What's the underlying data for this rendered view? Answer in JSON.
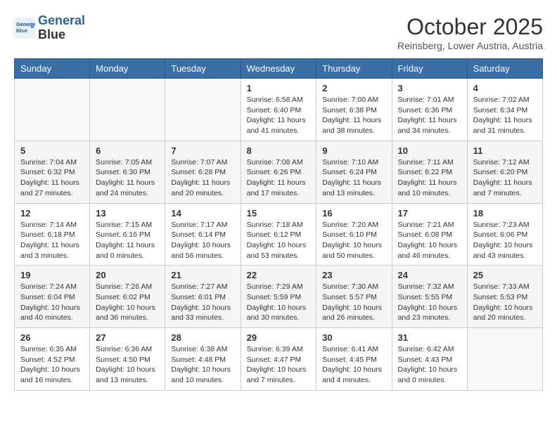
{
  "header": {
    "logo_line1": "General",
    "logo_line2": "Blue",
    "month": "October 2025",
    "location": "Reinsberg, Lower Austria, Austria"
  },
  "days_of_week": [
    "Sunday",
    "Monday",
    "Tuesday",
    "Wednesday",
    "Thursday",
    "Friday",
    "Saturday"
  ],
  "weeks": [
    [
      {
        "day": "",
        "sunrise": "",
        "sunset": "",
        "daylight": ""
      },
      {
        "day": "",
        "sunrise": "",
        "sunset": "",
        "daylight": ""
      },
      {
        "day": "",
        "sunrise": "",
        "sunset": "",
        "daylight": ""
      },
      {
        "day": "1",
        "sunrise": "Sunrise: 6:58 AM",
        "sunset": "Sunset: 6:40 PM",
        "daylight": "Daylight: 11 hours and 41 minutes."
      },
      {
        "day": "2",
        "sunrise": "Sunrise: 7:00 AM",
        "sunset": "Sunset: 6:38 PM",
        "daylight": "Daylight: 11 hours and 38 minutes."
      },
      {
        "day": "3",
        "sunrise": "Sunrise: 7:01 AM",
        "sunset": "Sunset: 6:36 PM",
        "daylight": "Daylight: 11 hours and 34 minutes."
      },
      {
        "day": "4",
        "sunrise": "Sunrise: 7:02 AM",
        "sunset": "Sunset: 6:34 PM",
        "daylight": "Daylight: 11 hours and 31 minutes."
      }
    ],
    [
      {
        "day": "5",
        "sunrise": "Sunrise: 7:04 AM",
        "sunset": "Sunset: 6:32 PM",
        "daylight": "Daylight: 11 hours and 27 minutes."
      },
      {
        "day": "6",
        "sunrise": "Sunrise: 7:05 AM",
        "sunset": "Sunset: 6:30 PM",
        "daylight": "Daylight: 11 hours and 24 minutes."
      },
      {
        "day": "7",
        "sunrise": "Sunrise: 7:07 AM",
        "sunset": "Sunset: 6:28 PM",
        "daylight": "Daylight: 11 hours and 20 minutes."
      },
      {
        "day": "8",
        "sunrise": "Sunrise: 7:08 AM",
        "sunset": "Sunset: 6:26 PM",
        "daylight": "Daylight: 11 hours and 17 minutes."
      },
      {
        "day": "9",
        "sunrise": "Sunrise: 7:10 AM",
        "sunset": "Sunset: 6:24 PM",
        "daylight": "Daylight: 11 hours and 13 minutes."
      },
      {
        "day": "10",
        "sunrise": "Sunrise: 7:11 AM",
        "sunset": "Sunset: 6:22 PM",
        "daylight": "Daylight: 11 hours and 10 minutes."
      },
      {
        "day": "11",
        "sunrise": "Sunrise: 7:12 AM",
        "sunset": "Sunset: 6:20 PM",
        "daylight": "Daylight: 11 hours and 7 minutes."
      }
    ],
    [
      {
        "day": "12",
        "sunrise": "Sunrise: 7:14 AM",
        "sunset": "Sunset: 6:18 PM",
        "daylight": "Daylight: 11 hours and 3 minutes."
      },
      {
        "day": "13",
        "sunrise": "Sunrise: 7:15 AM",
        "sunset": "Sunset: 6:16 PM",
        "daylight": "Daylight: 11 hours and 0 minutes."
      },
      {
        "day": "14",
        "sunrise": "Sunrise: 7:17 AM",
        "sunset": "Sunset: 6:14 PM",
        "daylight": "Daylight: 10 hours and 56 minutes."
      },
      {
        "day": "15",
        "sunrise": "Sunrise: 7:18 AM",
        "sunset": "Sunset: 6:12 PM",
        "daylight": "Daylight: 10 hours and 53 minutes."
      },
      {
        "day": "16",
        "sunrise": "Sunrise: 7:20 AM",
        "sunset": "Sunset: 6:10 PM",
        "daylight": "Daylight: 10 hours and 50 minutes."
      },
      {
        "day": "17",
        "sunrise": "Sunrise: 7:21 AM",
        "sunset": "Sunset: 6:08 PM",
        "daylight": "Daylight: 10 hours and 46 minutes."
      },
      {
        "day": "18",
        "sunrise": "Sunrise: 7:23 AM",
        "sunset": "Sunset: 6:06 PM",
        "daylight": "Daylight: 10 hours and 43 minutes."
      }
    ],
    [
      {
        "day": "19",
        "sunrise": "Sunrise: 7:24 AM",
        "sunset": "Sunset: 6:04 PM",
        "daylight": "Daylight: 10 hours and 40 minutes."
      },
      {
        "day": "20",
        "sunrise": "Sunrise: 7:26 AM",
        "sunset": "Sunset: 6:02 PM",
        "daylight": "Daylight: 10 hours and 36 minutes."
      },
      {
        "day": "21",
        "sunrise": "Sunrise: 7:27 AM",
        "sunset": "Sunset: 6:01 PM",
        "daylight": "Daylight: 10 hours and 33 minutes."
      },
      {
        "day": "22",
        "sunrise": "Sunrise: 7:29 AM",
        "sunset": "Sunset: 5:59 PM",
        "daylight": "Daylight: 10 hours and 30 minutes."
      },
      {
        "day": "23",
        "sunrise": "Sunrise: 7:30 AM",
        "sunset": "Sunset: 5:57 PM",
        "daylight": "Daylight: 10 hours and 26 minutes."
      },
      {
        "day": "24",
        "sunrise": "Sunrise: 7:32 AM",
        "sunset": "Sunset: 5:55 PM",
        "daylight": "Daylight: 10 hours and 23 minutes."
      },
      {
        "day": "25",
        "sunrise": "Sunrise: 7:33 AM",
        "sunset": "Sunset: 5:53 PM",
        "daylight": "Daylight: 10 hours and 20 minutes."
      }
    ],
    [
      {
        "day": "26",
        "sunrise": "Sunrise: 6:35 AM",
        "sunset": "Sunset: 4:52 PM",
        "daylight": "Daylight: 10 hours and 16 minutes."
      },
      {
        "day": "27",
        "sunrise": "Sunrise: 6:36 AM",
        "sunset": "Sunset: 4:50 PM",
        "daylight": "Daylight: 10 hours and 13 minutes."
      },
      {
        "day": "28",
        "sunrise": "Sunrise: 6:38 AM",
        "sunset": "Sunset: 4:48 PM",
        "daylight": "Daylight: 10 hours and 10 minutes."
      },
      {
        "day": "29",
        "sunrise": "Sunrise: 6:39 AM",
        "sunset": "Sunset: 4:47 PM",
        "daylight": "Daylight: 10 hours and 7 minutes."
      },
      {
        "day": "30",
        "sunrise": "Sunrise: 6:41 AM",
        "sunset": "Sunset: 4:45 PM",
        "daylight": "Daylight: 10 hours and 4 minutes."
      },
      {
        "day": "31",
        "sunrise": "Sunrise: 6:42 AM",
        "sunset": "Sunset: 4:43 PM",
        "daylight": "Daylight: 10 hours and 0 minutes."
      },
      {
        "day": "",
        "sunrise": "",
        "sunset": "",
        "daylight": ""
      }
    ]
  ]
}
